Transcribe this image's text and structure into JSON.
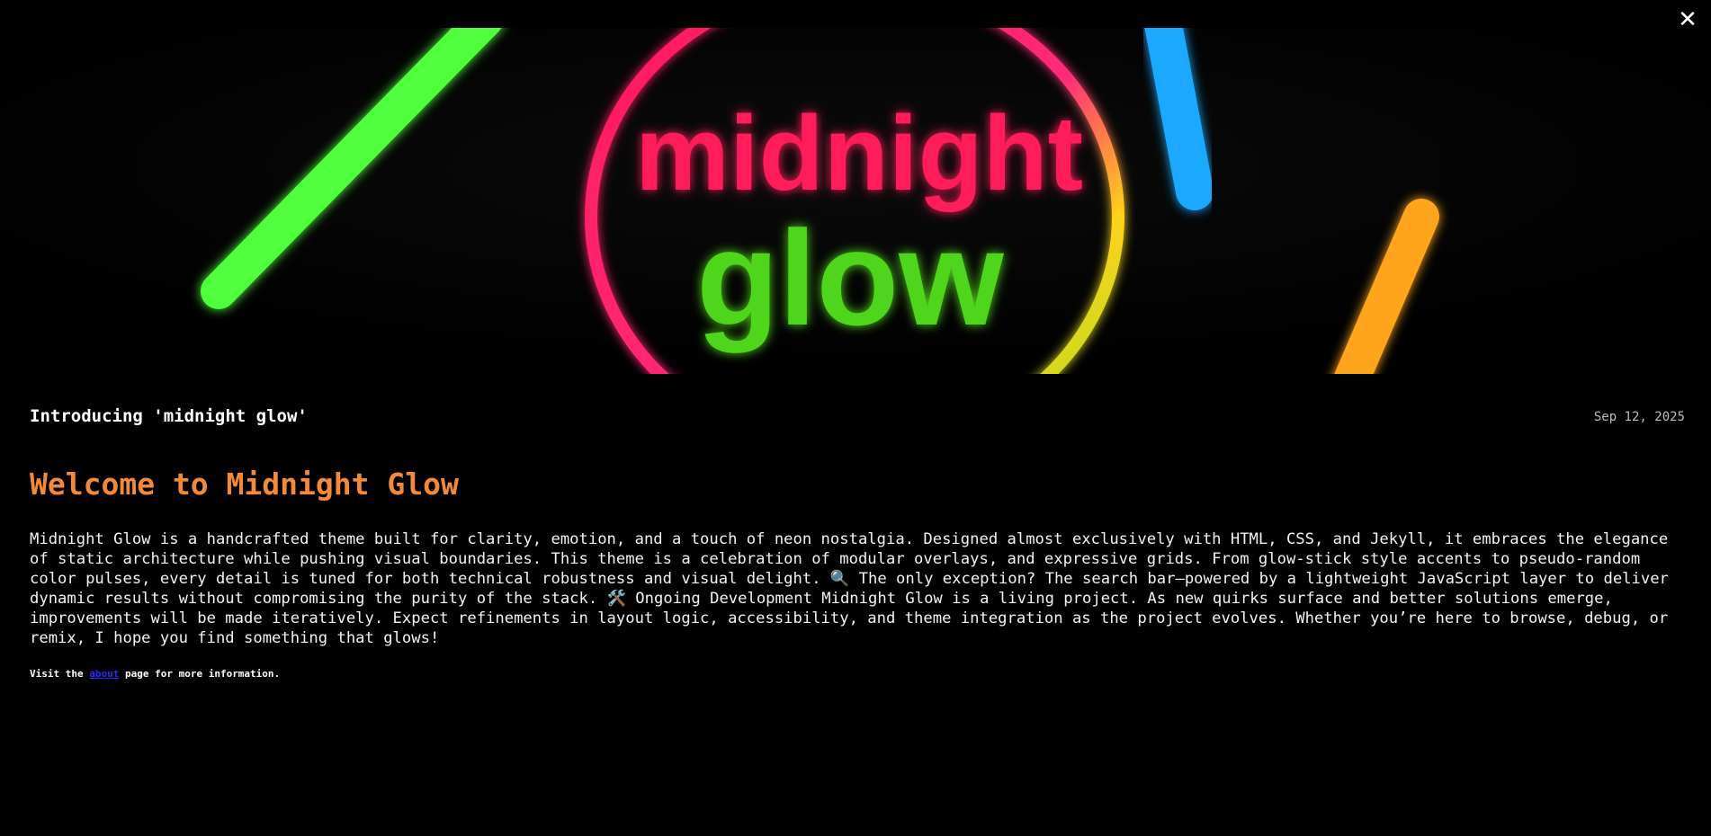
{
  "close": {
    "icon": "close-icon",
    "glyph": "✕"
  },
  "hero": {
    "image_name": "midnight-glow-hero",
    "logo_word_1": "midnight",
    "logo_word_2": "glow",
    "colors": {
      "green": "#4fff3a",
      "pink": "#ff1a5a",
      "blue": "#1aa8ff",
      "orange": "#ffa51a",
      "yellow": "#ffd21a"
    }
  },
  "post": {
    "title": "Introducing 'midnight glow'",
    "date": "Sep 12, 2025"
  },
  "article": {
    "heading": "Welcome to Midnight Glow",
    "body": "Midnight Glow is a handcrafted theme built for clarity, emotion, and a touch of neon nostalgia. Designed almost exclusively with HTML, CSS, and Jekyll, it embraces the elegance of static architecture while pushing visual boundaries. This theme is a celebration of modular overlays, and expressive grids. From glow-stick style accents to pseudo-random color pulses, every detail is tuned for both technical robustness and visual delight. 🔍 The only exception? The search bar—powered by a lightweight JavaScript layer to deliver dynamic results without compromising the purity of the stack. 🛠️ Ongoing Development Midnight Glow is a living project. As new quirks surface and better solutions emerge, improvements will be made iteratively. Expect refinements in layout logic, accessibility, and theme integration as the project evolves. Whether you’re here to browse, debug, or remix, I hope you find something that glows!",
    "visit_prefix": "Visit the ",
    "visit_link": "about",
    "visit_suffix": " page for more information."
  },
  "colors": {
    "background": "#000000",
    "heading": "#f28a3a",
    "link": "#2a2aff",
    "date": "#bdbdbd"
  }
}
